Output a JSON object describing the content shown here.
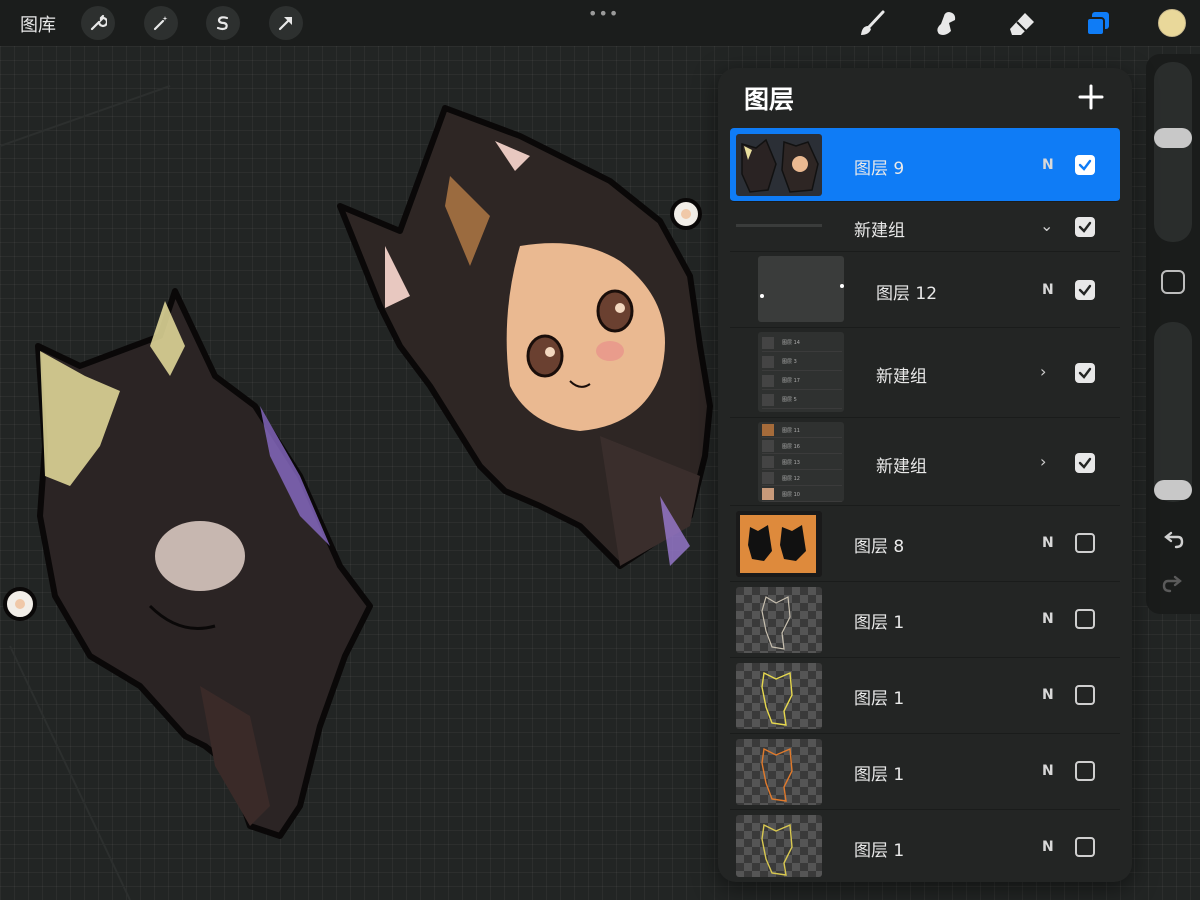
{
  "topbar": {
    "gallery_label": "图库",
    "tools": [
      "wrench-icon",
      "magic-wand-icon",
      "selection-s-icon",
      "arrow-icon"
    ],
    "right_tools": [
      "brush-icon",
      "smudge-icon",
      "eraser-icon",
      "layers-icon"
    ],
    "current_color": "#e9d89a",
    "accent_color": "#0f7cf6"
  },
  "layers_panel": {
    "title": "图层",
    "layers": [
      {
        "name": "图层 9",
        "blend": "N",
        "visible": true,
        "active": true,
        "type": "layer"
      },
      {
        "name": "新建组",
        "blend": "",
        "visible": true,
        "active": false,
        "type": "group-expanded"
      },
      {
        "name": "图层 12",
        "blend": "N",
        "visible": true,
        "active": false,
        "type": "layer"
      },
      {
        "name": "新建组",
        "blend": "",
        "visible": true,
        "active": false,
        "type": "group-collapsed"
      },
      {
        "name": "新建组",
        "blend": "",
        "visible": true,
        "active": false,
        "type": "group-collapsed"
      },
      {
        "name": "图层 8",
        "blend": "N",
        "visible": false,
        "active": false,
        "type": "layer"
      },
      {
        "name": "图层 1",
        "blend": "N",
        "visible": false,
        "active": false,
        "type": "layer"
      },
      {
        "name": "图层 1",
        "blend": "N",
        "visible": false,
        "active": false,
        "type": "layer"
      },
      {
        "name": "图层 1",
        "blend": "N",
        "visible": false,
        "active": false,
        "type": "layer"
      },
      {
        "name": "图层 1",
        "blend": "N",
        "visible": false,
        "active": false,
        "type": "layer"
      }
    ],
    "group_thumb_a": [
      "图层 14",
      "图层 3",
      "图层 17",
      "图层 5"
    ],
    "group_thumb_b": [
      "图层 11",
      "图层 16",
      "图层 13",
      "图层 12",
      "图层 10"
    ]
  }
}
